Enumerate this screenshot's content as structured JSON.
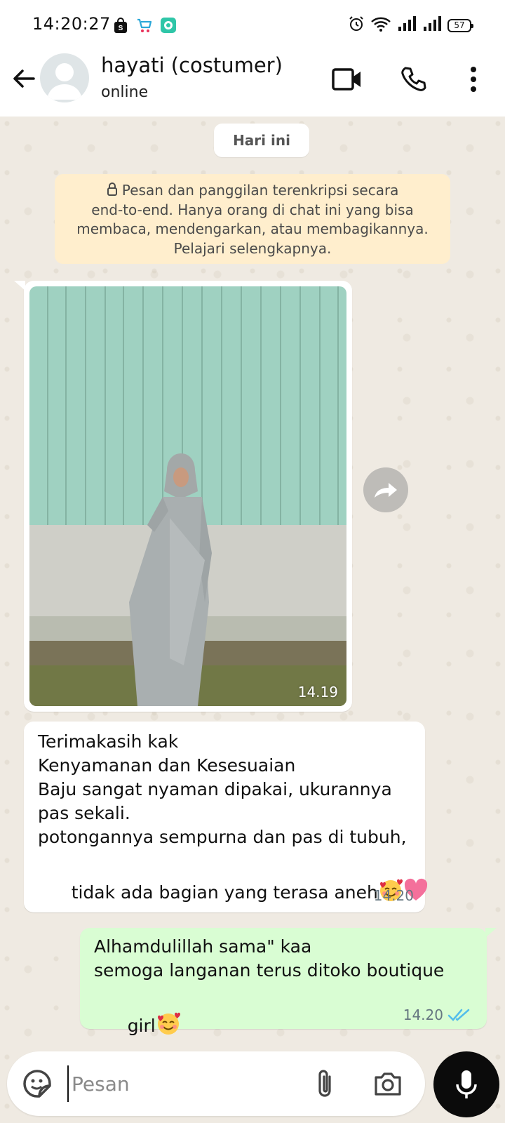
{
  "status_bar": {
    "time": "14:20:27",
    "battery": "57",
    "app_icons": [
      "shopping-bag-icon",
      "cart-icon",
      "chat-app-icon"
    ],
    "status_icons": [
      "alarm-icon",
      "wifi-icon",
      "signal-icon",
      "signal-icon"
    ]
  },
  "header": {
    "contact_name": "hayati (costumer)",
    "contact_status": "online"
  },
  "chat": {
    "date_chip": "Hari ini",
    "encryption_notice": {
      "lines": [
        "Pesan dan panggilan terenkripsi secara",
        "end-to-end. Hanya orang di chat ini yang bisa",
        "membaca, mendengarkan, atau membagikannya.",
        "Pelajari selengkapnya."
      ]
    },
    "messages": [
      {
        "type": "image",
        "direction": "incoming",
        "time": "14.19"
      },
      {
        "type": "text",
        "direction": "incoming",
        "lines": [
          "Terimakasih kak",
          "Kenyamanan dan Kesesuaian",
          "Baju sangat nyaman dipakai, ukurannya",
          "pas sekali.",
          "potongannya sempurna dan pas di tubuh,",
          "tidak ada bagian yang terasa aneh"
        ],
        "emojis": [
          "smiling-face-with-hearts",
          "pink-heart"
        ],
        "time": "14.20"
      },
      {
        "type": "text",
        "direction": "outgoing",
        "lines": [
          "Alhamdulillah sama\" kaa",
          "semoga langanan terus ditoko boutique",
          "girl"
        ],
        "emojis": [
          "smiling-face-with-hearts"
        ],
        "time": "14.20",
        "read_status": "read"
      }
    ]
  },
  "input": {
    "placeholder": "Pesan"
  },
  "colors": {
    "chat_background": "#efeae2",
    "incoming_bubble": "#ffffff",
    "outgoing_bubble": "#d9fdd3",
    "encryption_notice_bg": "#ffeecd",
    "read_ticks": "#53bdeb",
    "mic_button": "#0b0b0b"
  }
}
